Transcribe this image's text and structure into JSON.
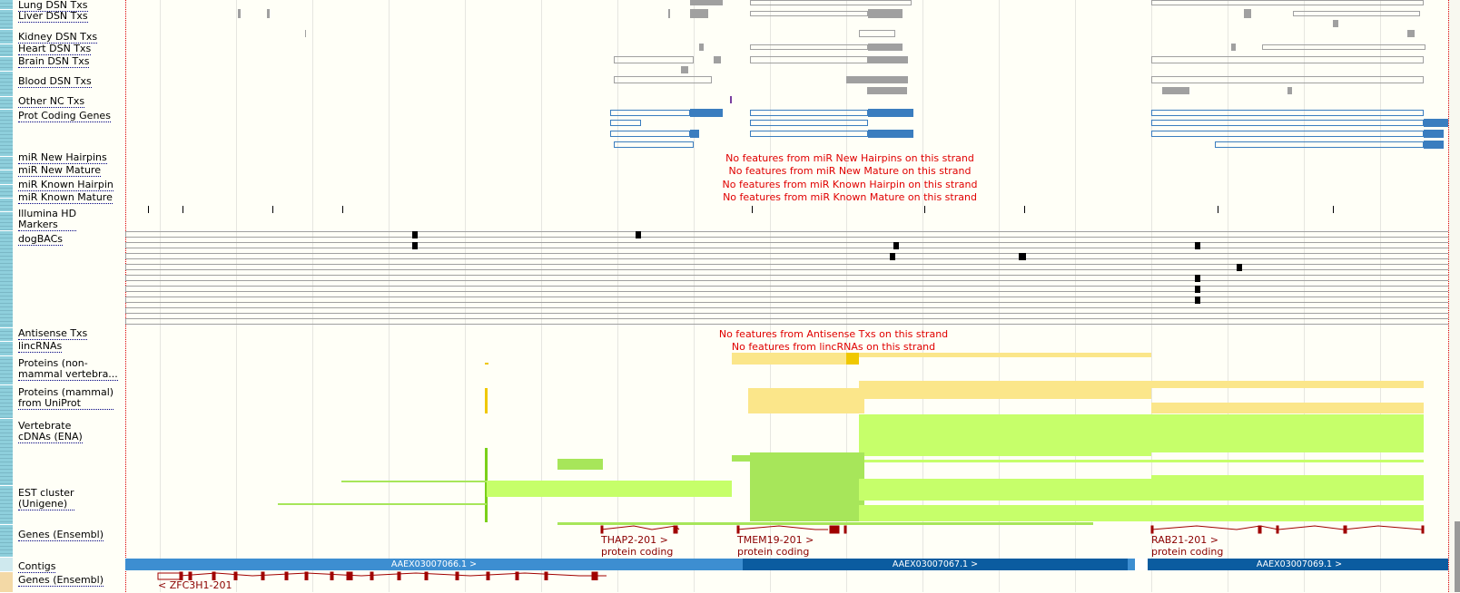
{
  "tracks": [
    {
      "id": "lung",
      "label": "Lung DSN Txs"
    },
    {
      "id": "liver",
      "label": "Liver DSN Txs"
    },
    {
      "id": "kidney",
      "label": "Kidney DSN Txs"
    },
    {
      "id": "heart",
      "label": "Heart DSN Txs"
    },
    {
      "id": "brain",
      "label": "Brain DSN Txs"
    },
    {
      "id": "blood",
      "label": "Blood DSN Txs"
    },
    {
      "id": "othernc",
      "label": "Other NC Txs"
    },
    {
      "id": "protcoding",
      "label": "Prot Coding Genes"
    },
    {
      "id": "mirnewhp",
      "label": "miR New Hairpins"
    },
    {
      "id": "mirnewmat",
      "label": "miR New Mature"
    },
    {
      "id": "mirknownhp",
      "label": "miR Known Hairpin"
    },
    {
      "id": "mirknownmat",
      "label": "miR Known Mature"
    },
    {
      "id": "illumina",
      "label": "Illumina HD Markers"
    },
    {
      "id": "dogbacs",
      "label": "dogBACs"
    },
    {
      "id": "antisense",
      "label": "Antisense Txs"
    },
    {
      "id": "lincrna",
      "label": "lincRNAs"
    },
    {
      "id": "protnonmammal",
      "label": "Proteins (non-mammal vertebra..."
    },
    {
      "id": "protmammal",
      "label": "Proteins (mammal) from UniProt"
    },
    {
      "id": "vertcdna",
      "label": "Vertebrate cDNAs (ENA)"
    },
    {
      "id": "est",
      "label": "EST cluster (Unigene)"
    },
    {
      "id": "genes1",
      "label": "Genes (Ensembl)"
    },
    {
      "id": "contigs",
      "label": "Contigs"
    },
    {
      "id": "genes2",
      "label": "Genes (Ensembl)"
    }
  ],
  "labels": {
    "lung": "Lung DSN Txs",
    "liver": "Liver DSN Txs",
    "kidney": "Kidney DSN Txs",
    "heart": "Heart DSN Txs",
    "brain": "Brain DSN Txs",
    "blood": "Blood DSN Txs",
    "othernc": "Other NC Txs",
    "protcoding": "Prot Coding Genes",
    "mirnewhp": "miR New Hairpins",
    "mirnewmat": "miR New Mature",
    "mirknownhp": "miR Known Hairpin",
    "mirknownmat": "miR Known Mature",
    "illumina_1": "Illumina HD",
    "illumina_2": "Markers",
    "dogbacs": "dogBACs",
    "antisense": "Antisense Txs",
    "lincrna": "lincRNAs",
    "protnonmammal_1": "Proteins (non-",
    "protnonmammal_2": "mammal vertebra...",
    "protmammal_1": "Proteins (mammal)",
    "protmammal_2": "from UniProt",
    "vertcdna_1": "Vertebrate",
    "vertcdna_2": "cDNAs (ENA)",
    "est_1": "EST cluster",
    "est_2": "(Unigene)",
    "genes1": "Genes (Ensembl)",
    "contigs": "Contigs",
    "genes2": "Genes (Ensembl)"
  },
  "no_features": {
    "mir_new_hairpins": "No features from miR New Hairpins on this strand",
    "mir_new_mature": "No features from miR New Mature on this strand",
    "mir_known_hairpin": "No features from miR Known Hairpin on this strand",
    "mir_known_mature": "No features from miR Known Mature on this strand",
    "antisense": "No features from Antisense Txs on this strand",
    "lincrna": "No features from lincRNAs on this strand"
  },
  "genes": {
    "thap2": {
      "name": "THAP2-201 >",
      "biotype": "protein coding"
    },
    "tmem19": {
      "name": "TMEM19-201 >",
      "biotype": "protein coding"
    },
    "rab21": {
      "name": "RAB21-201 >",
      "biotype": "protein coding"
    },
    "zfc3h1": {
      "name": "< ZFC3H1-201"
    }
  },
  "contigs": {
    "c1": "AAEX03007066.1 >",
    "c2": "AAEX03007067.1 >",
    "c3": "AAEX03007069.1 >"
  },
  "colors": {
    "dsn_grey": "#a0a0a0",
    "protein_coding_blue": "#3a7dbf",
    "uniprot_yellow": "#fbe68a",
    "ena_green": "#c6ff6a",
    "est_green": "#a7e65a",
    "gene_red": "#a00000",
    "contig_blue_1": "#3d8ed1",
    "contig_blue_2": "#0b5ca0",
    "no_feature_red": "#e00000"
  }
}
